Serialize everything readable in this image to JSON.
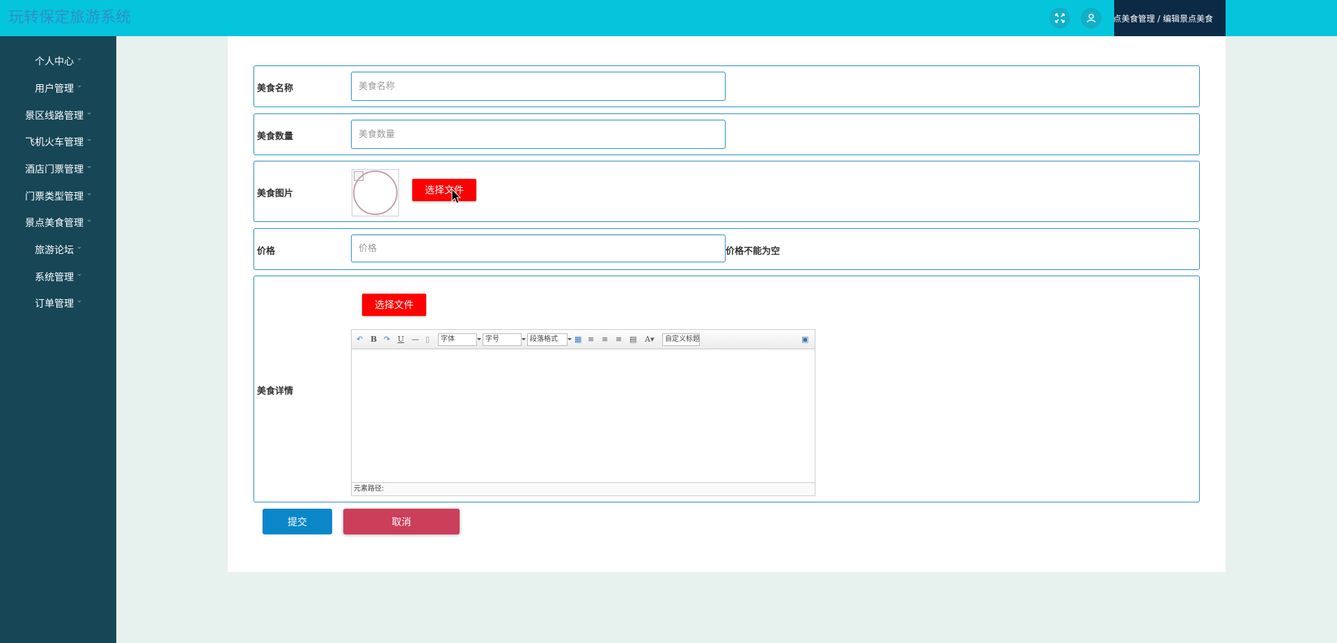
{
  "header": {
    "app_title": "玩转保定旅游系统",
    "breadcrumb": "景点美食管理 / 编辑景点美食"
  },
  "sidebar": {
    "items": [
      {
        "label": "个人中心"
      },
      {
        "label": "用户管理"
      },
      {
        "label": "景区线路管理"
      },
      {
        "label": "飞机火车管理"
      },
      {
        "label": "酒店门票管理"
      },
      {
        "label": "门票类型管理"
      },
      {
        "label": "景点美食管理"
      },
      {
        "label": "旅游论坛"
      },
      {
        "label": "系统管理"
      },
      {
        "label": "订单管理"
      }
    ]
  },
  "form": {
    "name": {
      "label": "美食名称",
      "placeholder": "美食名称",
      "value": ""
    },
    "quantity": {
      "label": "美食数量",
      "placeholder": "美食数量",
      "value": ""
    },
    "image": {
      "label": "美食图片",
      "file_button": "选择文件"
    },
    "price": {
      "label": "价格",
      "placeholder": "价格",
      "value": "",
      "validation": "价格不能为空"
    },
    "details": {
      "label": "美食详情",
      "file_button": "选择文件",
      "toolbar": {
        "font_family": "字体",
        "font_size": "字号",
        "paragraph": "段落格式",
        "custom_title": "自定义标题"
      },
      "status_path": "元素路径:"
    },
    "submit_label": "提交",
    "cancel_label": "取消"
  },
  "colors": {
    "topbar": "#05c5dc",
    "sidebar": "#174657",
    "accent_border": "#2a8fc5",
    "file_button": "#ff0000",
    "submit": "#0b86c9",
    "cancel": "#cc3f5b"
  }
}
